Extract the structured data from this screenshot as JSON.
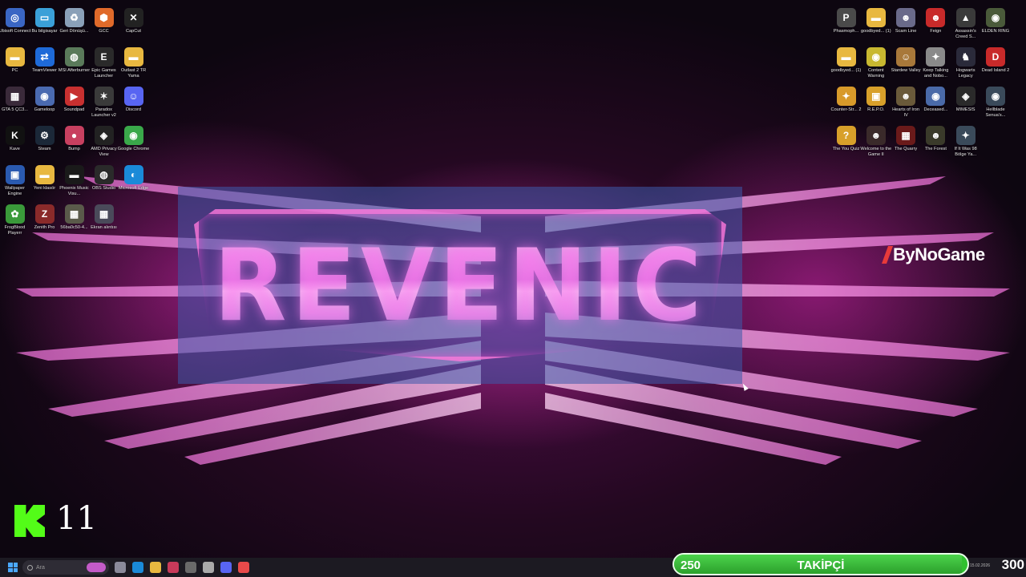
{
  "desktop": {
    "left_icons": [
      {
        "label": "Ubisoft Connect",
        "icon": "ubisoft-icon",
        "color": "#3a66c4",
        "glyph": "◎"
      },
      {
        "label": "Bu bilgisayar",
        "icon": "computer-icon",
        "color": "#3aa0d8",
        "glyph": "▭"
      },
      {
        "label": "Geri Dönüşü...",
        "icon": "recycle-bin-icon",
        "color": "#8aa0b8",
        "glyph": "♻"
      },
      {
        "label": "GCC",
        "icon": "gcc-icon",
        "color": "#e06a2a",
        "glyph": "⬢"
      },
      {
        "label": "CapCut",
        "icon": "capcut-icon",
        "color": "#222222",
        "glyph": "✕"
      },
      {
        "label": "PC",
        "icon": "folder-icon",
        "color": "#e8b840",
        "glyph": "▬"
      },
      {
        "label": "TeamViewer",
        "icon": "teamviewer-icon",
        "color": "#1e6ad8",
        "glyph": "⇄"
      },
      {
        "label": "MSI Afterburner",
        "icon": "afterburner-icon",
        "color": "#5a7a5a",
        "glyph": "◍"
      },
      {
        "label": "Epic Games Launcher",
        "icon": "epic-games-icon",
        "color": "#2a2a2a",
        "glyph": "E"
      },
      {
        "label": "Outlast 2 TR Yama",
        "icon": "folder-icon",
        "color": "#e8b840",
        "glyph": "▬"
      },
      {
        "label": "GTA 5 ÇC3...",
        "icon": "game-icon",
        "color": "#3a2a3a",
        "glyph": "▦"
      },
      {
        "label": "Gameloop",
        "icon": "gameloop-icon",
        "color": "#4a6ab0",
        "glyph": "◉"
      },
      {
        "label": "Soundpad",
        "icon": "soundpad-icon",
        "color": "#c83030",
        "glyph": "▶"
      },
      {
        "label": "Paradox Launcher v2",
        "icon": "paradox-icon",
        "color": "#3a3a3a",
        "glyph": "✶"
      },
      {
        "label": "Discord",
        "icon": "discord-icon",
        "color": "#5865f2",
        "glyph": "☺"
      },
      {
        "label": "Kave",
        "icon": "kave-icon",
        "color": "#111111",
        "glyph": "K"
      },
      {
        "label": "Steam",
        "icon": "steam-icon",
        "color": "#1b2838",
        "glyph": "⚙"
      },
      {
        "label": "Bump",
        "icon": "bump-icon",
        "color": "#c84060",
        "glyph": "●"
      },
      {
        "label": "AMD Privacy View",
        "icon": "amd-icon",
        "color": "#222222",
        "glyph": "◈"
      },
      {
        "label": "Google Chrome",
        "icon": "chrome-icon",
        "color": "#3aa84a",
        "glyph": "◉"
      },
      {
        "label": "Wallpaper Engine",
        "icon": "wallpaper-engine-icon",
        "color": "#2a5ab0",
        "glyph": "▣"
      },
      {
        "label": "Yeni klasör",
        "icon": "folder-icon",
        "color": "#e8b840",
        "glyph": "▬"
      },
      {
        "label": "Phoenix Music Visu...",
        "icon": "phoenix-icon",
        "color": "#1a1a1a",
        "glyph": "▬"
      },
      {
        "label": "OBS Studio",
        "icon": "obs-icon",
        "color": "#2a2a2a",
        "glyph": "◍"
      },
      {
        "label": "Microsoft Edge",
        "icon": "edge-icon",
        "color": "#1a8ad8",
        "glyph": "◐"
      },
      {
        "label": "FrogBlood Playerr",
        "icon": "frog-icon",
        "color": "#3a9a3a",
        "glyph": "✿"
      },
      {
        "label": "Zenith Pro",
        "icon": "zenith-icon",
        "color": "#8a2a2a",
        "glyph": "Z"
      },
      {
        "label": "56ba0c50-4...",
        "icon": "image-file-icon",
        "color": "#5a5a4a",
        "glyph": "▦"
      },
      {
        "label": "Ekran alıntısı",
        "icon": "screenshot-icon",
        "color": "#4a4a5a",
        "glyph": "▦"
      }
    ],
    "right_icons": [
      {
        "label": "Phasmoph...",
        "icon": "phasmophobia-icon",
        "color": "#4a4a4a",
        "glyph": "P"
      },
      {
        "label": "goodbyed... (1)",
        "icon": "folder-icon",
        "color": "#e8b840",
        "glyph": "▬"
      },
      {
        "label": "Scam Line",
        "icon": "scam-line-icon",
        "color": "#6a6a8a",
        "glyph": "☻"
      },
      {
        "label": "Feign",
        "icon": "feign-icon",
        "color": "#c82a2a",
        "glyph": "☻"
      },
      {
        "label": "Assassin's Creed S...",
        "icon": "assassins-creed-icon",
        "color": "#3a3a3a",
        "glyph": "▲"
      },
      {
        "label": "ELDEN RING",
        "icon": "elden-ring-icon",
        "color": "#4a5a3a",
        "glyph": "◉"
      },
      {
        "label": "goodbyed... (1)",
        "icon": "folder-icon",
        "color": "#e8b840",
        "glyph": "▬"
      },
      {
        "label": "Content Warning",
        "icon": "content-warning-icon",
        "color": "#c8b830",
        "glyph": "◉"
      },
      {
        "label": "Stardew Valley",
        "icon": "stardew-icon",
        "color": "#a8783a",
        "glyph": "☺"
      },
      {
        "label": "Keep Talking and Nobo...",
        "icon": "keep-talking-icon",
        "color": "#8a8a8a",
        "glyph": "✦"
      },
      {
        "label": "Hogwarts Legacy",
        "icon": "hogwarts-icon",
        "color": "#2a2a3a",
        "glyph": "♞"
      },
      {
        "label": "Dead Island 2",
        "icon": "dead-island-icon",
        "color": "#c82a2a",
        "glyph": "D"
      },
      {
        "label": "Counter-Str... 2",
        "icon": "cs2-icon",
        "color": "#d89a2a",
        "glyph": "✦"
      },
      {
        "label": "R.E.P.O.",
        "icon": "repo-icon",
        "color": "#d8a02a",
        "glyph": "▣"
      },
      {
        "label": "Hearts of Iron IV",
        "icon": "hoi4-icon",
        "color": "#6a5a3a",
        "glyph": "☻"
      },
      {
        "label": "Deceased...",
        "icon": "game-icon",
        "color": "#4a6aa8",
        "glyph": "◉"
      },
      {
        "label": "MIMESIS",
        "icon": "mimesis-icon",
        "color": "#2a2a2a",
        "glyph": "◈"
      },
      {
        "label": "Hellblade Senua's...",
        "icon": "hellblade-icon",
        "color": "#3a4a5a",
        "glyph": "◉"
      },
      {
        "label": "The You Quiz",
        "icon": "you-quiz-icon",
        "color": "#d8a02a",
        "glyph": "?"
      },
      {
        "label": "Welcome to the Game II",
        "icon": "welcome-game-icon",
        "color": "#3a2a2a",
        "glyph": "☻"
      },
      {
        "label": "The Quarry",
        "icon": "quarry-icon",
        "color": "#6a1a1a",
        "glyph": "▦"
      },
      {
        "label": "The Forest",
        "icon": "forest-icon",
        "color": "#3a3a2a",
        "glyph": "☻"
      },
      {
        "label": "If It Was 98 Bölge Ya...",
        "icon": "game-icon",
        "color": "#3a4a5a",
        "glyph": "✦"
      }
    ]
  },
  "banner": {
    "title": "REVENIC"
  },
  "brand": {
    "text": "ByNoGame"
  },
  "kick": {
    "count": "11",
    "accent": "#53fc18"
  },
  "taskbar": {
    "search_placeholder": "Ara",
    "apps": [
      {
        "icon": "task-view-icon",
        "color": "#8a8a9a"
      },
      {
        "icon": "edge-icon",
        "color": "#1a8ad8"
      },
      {
        "icon": "file-explorer-icon",
        "color": "#e8b840"
      },
      {
        "icon": "app-icon",
        "color": "#c83a5a"
      },
      {
        "icon": "app-icon",
        "color": "#6a6a6a"
      },
      {
        "icon": "app-icon",
        "color": "#aaaaaa"
      },
      {
        "icon": "discord-icon",
        "color": "#5865f2"
      },
      {
        "icon": "app-icon",
        "color": "#e84a4a"
      }
    ],
    "tray_date": "15.02.2026"
  },
  "follower_goal": {
    "min": "250",
    "label": "TAKİPÇİ",
    "max": "300",
    "progress_fraction": 0.98,
    "color": "#30c030"
  }
}
